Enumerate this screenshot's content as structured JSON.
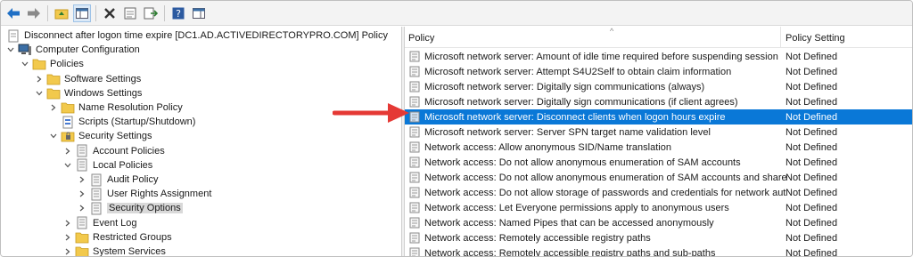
{
  "toolbar": {
    "buttons": [
      "back-icon",
      "forward-icon",
      "up-folder-icon",
      "show-hide-tree-icon",
      "delete-icon",
      "properties-icon",
      "export-list-icon",
      "help-icon",
      "show-hide-action-pane-icon"
    ]
  },
  "tree": {
    "items": [
      {
        "label": "Disconnect after logon time expire [DC1.AD.ACTIVEDIRECTORYPRO.COM] Policy",
        "icon": "gpo-document-icon",
        "level": 0,
        "chevron": ""
      },
      {
        "label": "Computer Configuration",
        "icon": "computer-icon",
        "level": 0,
        "chevron": "v"
      },
      {
        "label": "Policies",
        "icon": "folder-icon",
        "level": 1,
        "chevron": "v"
      },
      {
        "label": "Software Settings",
        "icon": "folder-icon",
        "level": 2,
        "chevron": ">"
      },
      {
        "label": "Windows Settings",
        "icon": "folder-icon",
        "level": 2,
        "chevron": "v"
      },
      {
        "label": "Name Resolution Policy",
        "icon": "folder-icon",
        "level": 3,
        "chevron": ">"
      },
      {
        "label": "Scripts (Startup/Shutdown)",
        "icon": "script-icon",
        "level": 3,
        "chevron": ""
      },
      {
        "label": "Security Settings",
        "icon": "security-icon",
        "level": 3,
        "chevron": "v"
      },
      {
        "label": "Account Policies",
        "icon": "policy-folder-icon",
        "level": 4,
        "chevron": ">"
      },
      {
        "label": "Local Policies",
        "icon": "policy-folder-icon",
        "level": 4,
        "chevron": "v"
      },
      {
        "label": "Audit Policy",
        "icon": "policy-folder-icon",
        "level": 5,
        "chevron": ">"
      },
      {
        "label": "User Rights Assignment",
        "icon": "policy-folder-icon",
        "level": 5,
        "chevron": ">"
      },
      {
        "label": "Security Options",
        "icon": "policy-folder-icon",
        "level": 5,
        "chevron": ">",
        "selected": true
      },
      {
        "label": "Event Log",
        "icon": "policy-folder-icon",
        "level": 4,
        "chevron": ">"
      },
      {
        "label": "Restricted Groups",
        "icon": "folder-icon",
        "level": 4,
        "chevron": ">"
      },
      {
        "label": "System Services",
        "icon": "folder-icon",
        "level": 4,
        "chevron": ">"
      }
    ]
  },
  "list": {
    "columns": {
      "policy": "Policy",
      "setting": "Policy Setting"
    },
    "rows": [
      {
        "policy": "Microsoft network server: Amount of idle time required before suspending session",
        "setting": "Not Defined"
      },
      {
        "policy": "Microsoft network server: Attempt S4U2Self to obtain claim information",
        "setting": "Not Defined"
      },
      {
        "policy": "Microsoft network server: Digitally sign communications (always)",
        "setting": "Not Defined"
      },
      {
        "policy": "Microsoft network server: Digitally sign communications (if client agrees)",
        "setting": "Not Defined"
      },
      {
        "policy": "Microsoft network server: Disconnect clients when logon hours expire",
        "setting": "Not Defined",
        "selected": true
      },
      {
        "policy": "Microsoft network server: Server SPN target name validation level",
        "setting": "Not Defined"
      },
      {
        "policy": "Network access: Allow anonymous SID/Name translation",
        "setting": "Not Defined"
      },
      {
        "policy": "Network access: Do not allow anonymous enumeration of SAM accounts",
        "setting": "Not Defined"
      },
      {
        "policy": "Network access: Do not allow anonymous enumeration of SAM accounts and shares",
        "setting": "Not Defined"
      },
      {
        "policy": "Network access: Do not allow storage of passwords and credentials for network aut...",
        "setting": "Not Defined"
      },
      {
        "policy": "Network access: Let Everyone permissions apply to anonymous users",
        "setting": "Not Defined"
      },
      {
        "policy": "Network access: Named Pipes that can be accessed anonymously",
        "setting": "Not Defined"
      },
      {
        "policy": "Network access: Remotely accessible registry paths",
        "setting": "Not Defined"
      },
      {
        "policy": "Network access: Remotely accessible registry paths and sub-paths",
        "setting": "Not Defined"
      }
    ]
  },
  "colors": {
    "selection": "#0a78d7",
    "arrow": "#e53935",
    "folder": "#f2c94c",
    "toolbar_bg": "#f3f3f3"
  }
}
